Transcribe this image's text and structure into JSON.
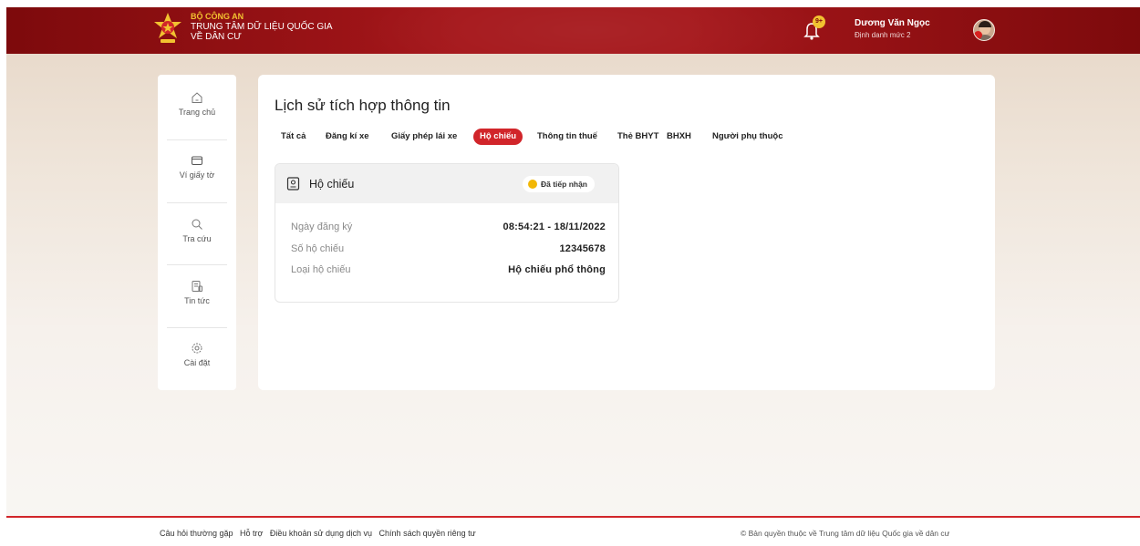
{
  "header": {
    "org": "BỘ CÔNG AN",
    "center_name_line1": "TRUNG TÂM DỮ LIỆU QUỐC GIA",
    "center_name_line2": "VỀ DÂN CƯ",
    "notification_count": "9+",
    "user_name": "Dương Văn Ngọc",
    "user_level": "Định danh mức 2"
  },
  "sidebar": {
    "items": [
      {
        "label": "Trang chủ",
        "icon": "home-icon"
      },
      {
        "label": "Ví giấy tờ",
        "icon": "wallet-icon"
      },
      {
        "label": "Tra cứu",
        "icon": "search-icon"
      },
      {
        "label": "Tin tức",
        "icon": "news-icon"
      },
      {
        "label": "Cài đặt",
        "icon": "gear-icon"
      }
    ]
  },
  "main": {
    "title": "Lịch sử tích hợp thông tin",
    "tabs": [
      {
        "label": "Tất cả"
      },
      {
        "label": "Đăng kí xe"
      },
      {
        "label": "Giấy phép lái xe"
      },
      {
        "label": "Hộ chiếu",
        "active": true
      },
      {
        "label": "Thông tin thuế"
      },
      {
        "label": "Thẻ BHYT"
      },
      {
        "label": "BHXH"
      },
      {
        "label": "Người phụ thuộc"
      }
    ],
    "card": {
      "title": "Hộ chiếu",
      "status": "Đã tiếp nhận",
      "status_color": "#f2b705",
      "rows": [
        {
          "label": "Ngày đăng ký",
          "value": "08:54:21 - 18/11/2022"
        },
        {
          "label": "Số hộ chiếu",
          "value": "12345678"
        },
        {
          "label": "Loại hộ chiếu",
          "value": "Hộ chiếu phổ thông"
        }
      ]
    }
  },
  "footer": {
    "links": [
      "Câu hỏi thường gặp",
      "Hỗ trợ",
      "Điều khoản sử dụng dịch vụ",
      "Chính sách quyền riêng tư"
    ],
    "copyright": "© Bản quyền thuộc về Trung tâm dữ liệu Quốc gia về dân cư"
  },
  "colors": {
    "brand_red": "#a5161a",
    "accent_red": "#d1252a",
    "gold": "#f2c230"
  }
}
